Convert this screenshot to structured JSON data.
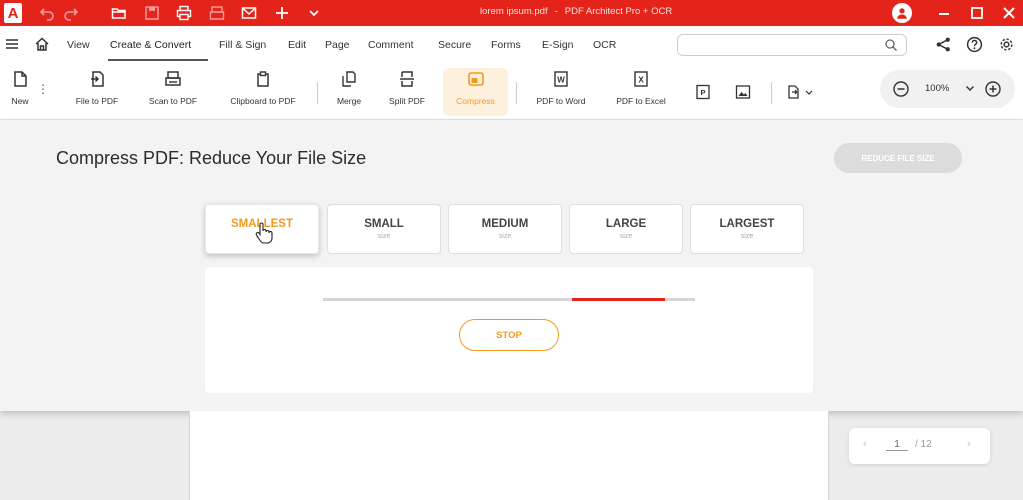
{
  "window": {
    "file_name": "lorem ipsum.pdf",
    "separator": "-",
    "app_name": "PDF Architect Pro + OCR",
    "logo_letter": "A"
  },
  "colors": {
    "brand_red": "#e4241b",
    "accent_orange": "#f29a1f"
  },
  "menu": {
    "items": [
      "View",
      "Create & Convert",
      "Fill & Sign",
      "Edit",
      "Page",
      "Comment",
      "Secure",
      "Forms",
      "E-Sign",
      "OCR"
    ],
    "active": "Create & Convert"
  },
  "search": {
    "value": "",
    "placeholder": ""
  },
  "ribbon": {
    "tools": [
      {
        "label": "New",
        "icon": "new-document-icon"
      },
      {
        "label": "File to PDF",
        "icon": "file-to-pdf-icon"
      },
      {
        "label": "Scan to PDF",
        "icon": "scanner-icon"
      },
      {
        "label": "Clipboard to PDF",
        "icon": "clipboard-icon"
      },
      {
        "label": "Merge",
        "icon": "merge-icon"
      },
      {
        "label": "Split PDF",
        "icon": "split-icon"
      },
      {
        "label": "Compress",
        "icon": "compress-icon"
      },
      {
        "label": "PDF to Word",
        "icon": "word-icon"
      },
      {
        "label": "PDF to Excel",
        "icon": "excel-icon"
      }
    ],
    "active_tool": "Compress",
    "small_tools": {
      "ppt": "P",
      "word": "W",
      "excel": "X"
    },
    "zoom": "100%"
  },
  "compress": {
    "title": "Compress PDF: Reduce Your File Size",
    "action_button": "REDUCE FILE SIZE",
    "sizes": [
      {
        "name": "SMALLEST",
        "sub": "size"
      },
      {
        "name": "SMALL",
        "sub": "size"
      },
      {
        "name": "MEDIUM",
        "sub": "size"
      },
      {
        "name": "LARGE",
        "sub": "size"
      },
      {
        "name": "LARGEST",
        "sub": "size"
      }
    ],
    "selected_size": "SMALLEST",
    "progress": {
      "start_fraction": 0.67,
      "end_fraction": 0.92
    },
    "stop_button": "STOP"
  },
  "pager": {
    "current_page": "1",
    "total": "/ 12",
    "prev": "‹",
    "next": "›"
  }
}
